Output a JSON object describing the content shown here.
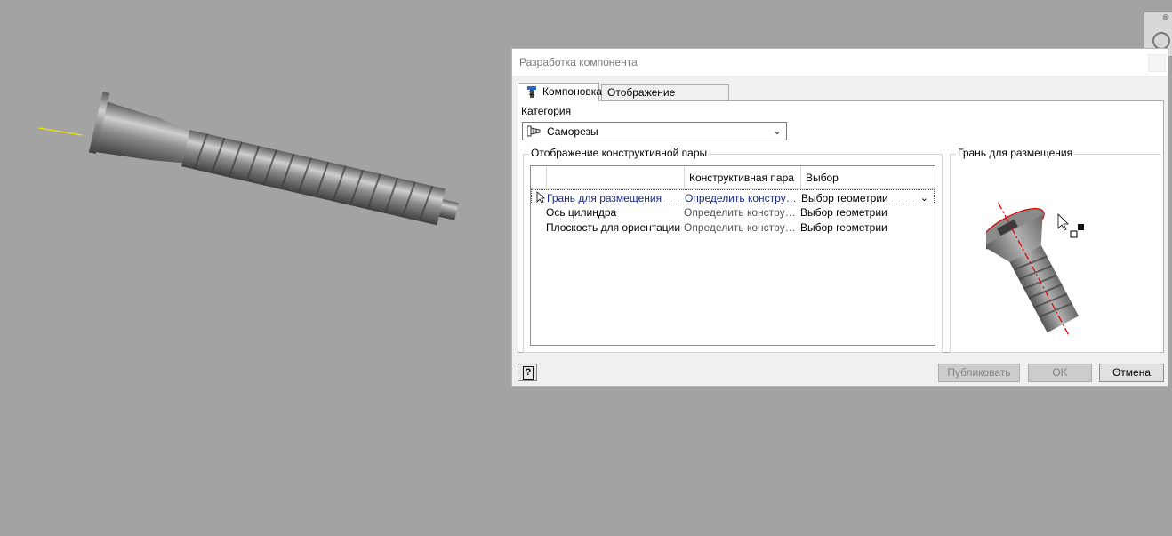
{
  "dialog": {
    "title": "Разработка компонента",
    "tabs": [
      {
        "label": "Компоновка",
        "active": true
      },
      {
        "label": "Отображение параметров",
        "active": false
      }
    ],
    "category": {
      "label": "Категория",
      "value": "Саморезы"
    },
    "pairs_group": {
      "title": "Отображение конструктивной пары",
      "columns": [
        "",
        "Конструктивная пара",
        "Выбор"
      ],
      "rows": [
        {
          "name": "Грань для размещения",
          "pair": "Определить конструктивную пару",
          "choice": "Выбор геометрии",
          "selected": true
        },
        {
          "name": "Ось цилиндра",
          "pair": "Определить конструктивную пару",
          "choice": "Выбор геометрии",
          "selected": false
        },
        {
          "name": "Плоскость для ориентации",
          "pair": "Определить конструктивную пару",
          "choice": "Выбор геометрии",
          "selected": false
        }
      ]
    },
    "preview_group": {
      "title": "Грань для размещения"
    },
    "buttons": {
      "help": "?",
      "publish": "Публиковать",
      "ok": "OK",
      "cancel": "Отмена"
    }
  },
  "colors": {
    "viewport_bg": "#a3a3a3",
    "accent_red": "#e00000",
    "axis_yellow": "#f2e600"
  },
  "icons": {
    "tab": "screw-icon",
    "category": "self-tapping-screw-icon",
    "help": "help-icon"
  }
}
